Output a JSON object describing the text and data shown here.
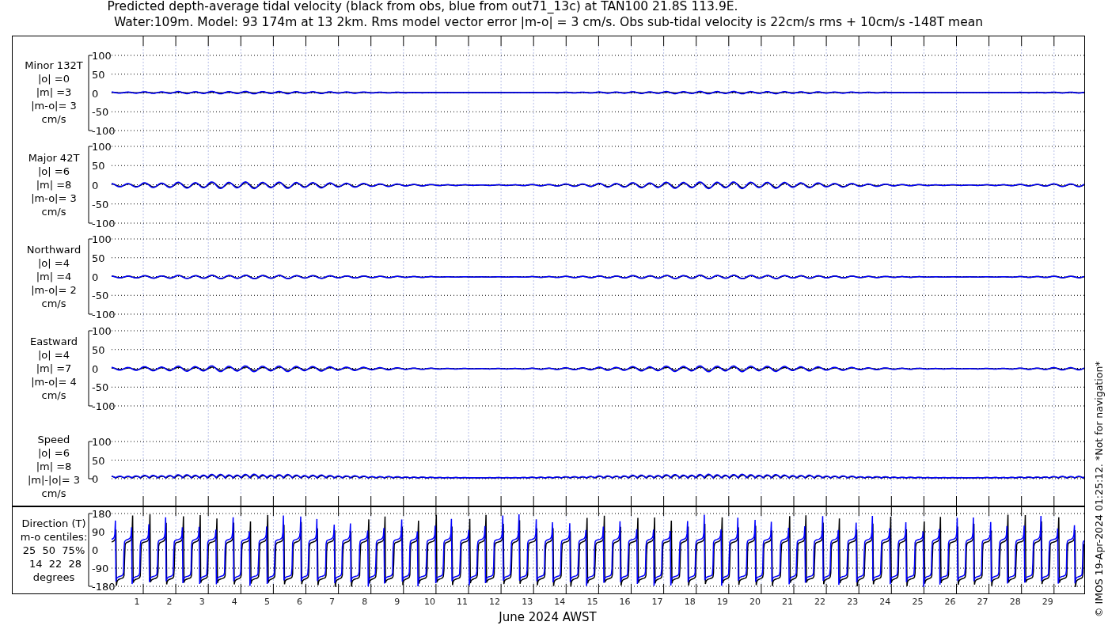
{
  "title_lines": [
    "Predicted depth-average tidal velocity (black from obs, blue from out71_13c) at TAN100 21.8S 113.9E.",
    "Water:109m. Model: 93 174m at 13 2km. Rms model vector error |m-o| = 3 cm/s. Obs sub-tidal velocity is 22cm/s rms + 10cm/s -148T mean"
  ],
  "panels": [
    {
      "kind": "velocity",
      "label_lines": [
        "Minor 132T",
        "|o| =0",
        "|m| =3",
        "|m-o|= 3",
        "cm/s"
      ],
      "yticks": [
        "100",
        "50",
        "0",
        "-50",
        "-100"
      ]
    },
    {
      "kind": "velocity",
      "label_lines": [
        "Major 42T",
        "|o| =6",
        "|m| =8",
        "|m-o|= 3",
        "cm/s"
      ],
      "yticks": [
        "100",
        "50",
        "0",
        "-50",
        "-100"
      ]
    },
    {
      "kind": "velocity",
      "label_lines": [
        "Northward",
        "|o| =4",
        "|m| =4",
        "|m-o|= 2",
        "cm/s"
      ],
      "yticks": [
        "100",
        "50",
        "0",
        "-50",
        "-100"
      ]
    },
    {
      "kind": "velocity",
      "label_lines": [
        "Eastward",
        "|o| =4",
        "|m| =7",
        "|m-o|= 4",
        "cm/s"
      ],
      "yticks": [
        "100",
        "50",
        "0",
        "-50",
        "-100"
      ]
    },
    {
      "kind": "speed",
      "label_lines": [
        "Speed",
        "|o| =6",
        "|m| =8",
        "|m|-|o|= 3",
        "cm/s"
      ],
      "yticks": [
        "100",
        "50",
        "0"
      ]
    },
    {
      "kind": "direction",
      "label_lines": [
        "Direction (T)",
        "m-o centiles:",
        "25  50  75%",
        " 14  22  28",
        "degrees"
      ],
      "yticks": [
        "180",
        "90",
        "0",
        "-90",
        "-180"
      ]
    }
  ],
  "x_axis": {
    "ticks": [
      "1",
      "2",
      "3",
      "4",
      "5",
      "6",
      "7",
      "8",
      "9",
      "10",
      "11",
      "12",
      "13",
      "14",
      "15",
      "16",
      "17",
      "18",
      "19",
      "20",
      "21",
      "22",
      "23",
      "24",
      "25",
      "26",
      "27",
      "28",
      "29"
    ],
    "label": "June 2024 AWST"
  },
  "credit": "© IMOS 19-Apr-2024 01:25:12. *Not for navigation*"
}
